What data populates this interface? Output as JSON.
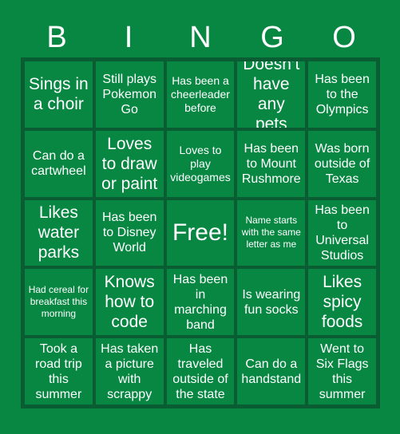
{
  "card": {
    "title_letters": [
      "B",
      "I",
      "N",
      "G",
      "O"
    ],
    "background_color": "#088743",
    "border_color": "#0a5c32",
    "text_color": "#ffffff",
    "rows": [
      [
        {
          "text": "Sings in a choir",
          "size": "lg"
        },
        {
          "text": "Still plays Pokemon Go",
          "size": "md"
        },
        {
          "text": "Has been a cheerleader before",
          "size": "sm"
        },
        {
          "text": "Doesn’t have any pets",
          "size": "lg"
        },
        {
          "text": "Has been to the Olympics",
          "size": "md"
        }
      ],
      [
        {
          "text": "Can do a cartwheel",
          "size": "md"
        },
        {
          "text": "Loves to draw or paint",
          "size": "lg"
        },
        {
          "text": "Loves to play videogames",
          "size": "sm"
        },
        {
          "text": "Has been to Mount Rushmore",
          "size": "md"
        },
        {
          "text": "Was born outside of Texas",
          "size": "md"
        }
      ],
      [
        {
          "text": "Likes water parks",
          "size": "lg"
        },
        {
          "text": "Has been to Disney World",
          "size": "md"
        },
        {
          "text": "Free!",
          "size": "xl"
        },
        {
          "text": "Name starts with the same letter as me",
          "size": "xs"
        },
        {
          "text": "Has been to Universal Studios",
          "size": "md"
        }
      ],
      [
        {
          "text": "Had cereal for breakfast this morning",
          "size": "xs"
        },
        {
          "text": "Knows how to code",
          "size": "lg"
        },
        {
          "text": "Has been in marching band",
          "size": "md"
        },
        {
          "text": "Is wearing fun socks",
          "size": "md"
        },
        {
          "text": "Likes spicy foods",
          "size": "lg"
        }
      ],
      [
        {
          "text": "Took a road trip this summer",
          "size": "md"
        },
        {
          "text": "Has taken a picture with scrappy",
          "size": "md"
        },
        {
          "text": "Has traveled outside of the state",
          "size": "md"
        },
        {
          "text": "Can do a handstand",
          "size": "md"
        },
        {
          "text": "Went to Six Flags this summer",
          "size": "md"
        }
      ]
    ]
  }
}
